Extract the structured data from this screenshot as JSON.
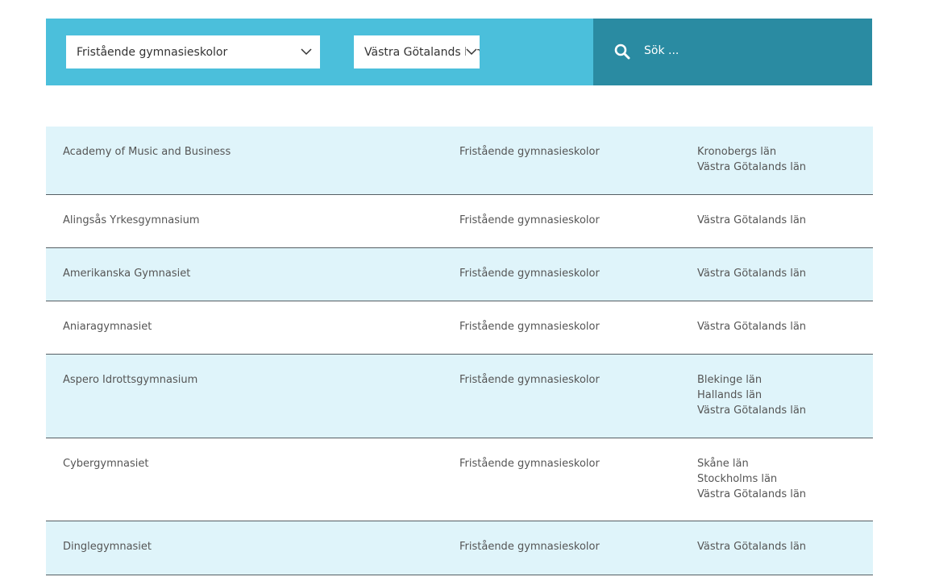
{
  "filters": {
    "school_type": "Fristående gymnasieskolor",
    "region": "Västra Götalands län",
    "search_placeholder": "Sök ..."
  },
  "icons": {
    "search": "search-icon",
    "chevron": "chevron-down-icon"
  },
  "colors": {
    "filter_bar": "#4bbfdb",
    "search_box": "#2a8ba2",
    "row_alt": "#dff4fa"
  },
  "schools": [
    {
      "name": "Academy of Music and Business",
      "type": "Fristående gymnasieskolor",
      "regions": [
        "Kronobergs län",
        "Västra Götalands län"
      ]
    },
    {
      "name": "Alingsås Yrkesgymnasium",
      "type": "Fristående gymnasieskolor",
      "regions": [
        "Västra Götalands län"
      ]
    },
    {
      "name": "Amerikanska Gymnasiet",
      "type": "Fristående gymnasieskolor",
      "regions": [
        "Västra Götalands län"
      ]
    },
    {
      "name": "Aniaragymnasiet",
      "type": "Fristående gymnasieskolor",
      "regions": [
        "Västra Götalands län"
      ]
    },
    {
      "name": "Aspero Idrottsgymnasium",
      "type": "Fristående gymnasieskolor",
      "regions": [
        "Blekinge län",
        "Hallands län",
        "Västra Götalands län"
      ]
    },
    {
      "name": "Cybergymnasiet",
      "type": "Fristående gymnasieskolor",
      "regions": [
        "Skåne län",
        "Stockholms län",
        "Västra Götalands län"
      ]
    },
    {
      "name": "Dinglegymnasiet",
      "type": "Fristående gymnasieskolor",
      "regions": [
        "Västra Götalands län"
      ]
    }
  ]
}
